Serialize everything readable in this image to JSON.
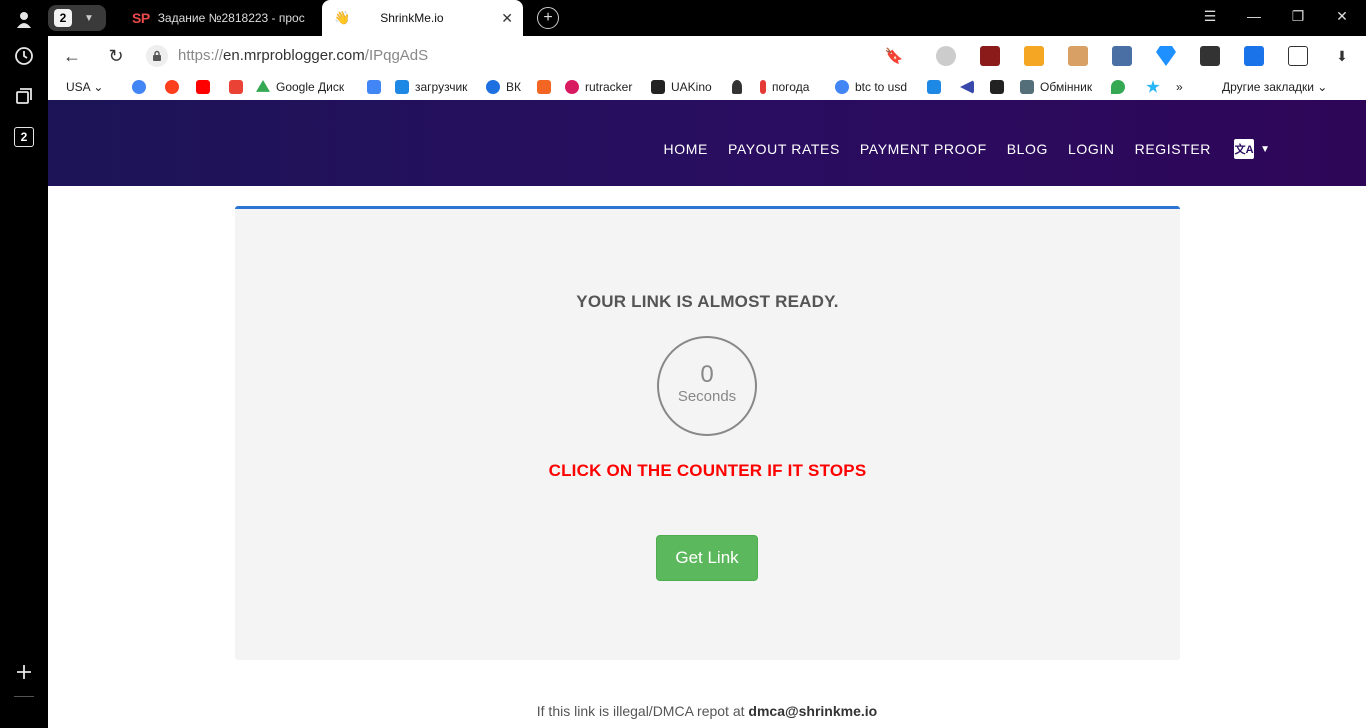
{
  "tabstrip": {
    "tab_count": "2",
    "tabs": [
      {
        "favicon": "SP",
        "title": "Задание №2818223 - прос"
      },
      {
        "favicon": "👋",
        "title": "ShrinkMe.io"
      }
    ],
    "new_tab": "+",
    "close": "✕"
  },
  "sidepanel": {
    "badge": "2"
  },
  "addressbar": {
    "protocol": "https://",
    "host": "en.mrproblogger.com",
    "path": "/IPqgAdS"
  },
  "bookmarks": {
    "items": [
      {
        "label": "USA ⌄",
        "icon": "none"
      },
      {
        "label": "",
        "icon": "google-icon",
        "color": "#4285f4"
      },
      {
        "label": "",
        "icon": "yandex-icon",
        "color": "#fc3f1d"
      },
      {
        "label": "",
        "icon": "youtube-icon",
        "color": "#ff0000"
      },
      {
        "label": "",
        "icon": "gmail-icon",
        "color": "#ea4335"
      },
      {
        "label": "Google Диск",
        "icon": "google-drive-icon",
        "color": "#34a853"
      },
      {
        "label": "",
        "icon": "translate-icon",
        "color": "#4285f4"
      },
      {
        "label": "загрузчик",
        "icon": "loader-icon",
        "color": "#1e88e5"
      },
      {
        "label": "ВК",
        "icon": "video-icon",
        "color": "#1e6fe0"
      },
      {
        "label": "",
        "icon": "f-icon",
        "color": "#f26522"
      },
      {
        "label": "rutracker",
        "icon": "rutracker-icon",
        "color": "#d81b60"
      },
      {
        "label": "UAKino",
        "icon": "uakino-icon",
        "color": "#222222"
      },
      {
        "label": "",
        "icon": "chess-icon",
        "color": "#333333"
      },
      {
        "label": "погода",
        "icon": "thermometer-icon",
        "color": "#e53935"
      },
      {
        "label": "btc to usd",
        "icon": "google-icon",
        "color": "#4285f4"
      },
      {
        "label": "",
        "icon": "p-icon",
        "color": "#1e88e5"
      },
      {
        "label": "",
        "icon": "arrow-icon",
        "color": "#3949ab"
      },
      {
        "label": "",
        "icon": "bc-icon",
        "color": "#222222"
      },
      {
        "label": "Обмінник",
        "icon": "exchange-icon",
        "color": "#546e7a"
      },
      {
        "label": "",
        "icon": "maps-icon",
        "color": "#34a853"
      },
      {
        "label": "",
        "icon": "star-icon",
        "color": "#29b6f6"
      },
      {
        "label": "»",
        "icon": "none"
      },
      {
        "label": "Другие закладки ⌄",
        "icon": "none"
      }
    ]
  },
  "site": {
    "menu": [
      "HOME",
      "PAYOUT RATES",
      "PAYMENT PROOF",
      "BLOG",
      "LOGIN",
      "REGISTER"
    ],
    "lang_flag": "文A"
  },
  "card": {
    "heading": "YOUR LINK IS ALMOST READY.",
    "counter_value": "0",
    "counter_unit": "Seconds",
    "warning": "CLICK ON THE COUNTER IF IT STOPS",
    "button": "Get Link"
  },
  "footer": {
    "text": "If this link is illegal/DMCA repot at ",
    "email": "dmca@shrinkme.io"
  },
  "colors": {
    "nav_gradient_start": "#1c1457",
    "nav_gradient_end": "#2e0658",
    "card_accent": "#2b74d2",
    "warning": "#ff0000",
    "button": "#5cb85c"
  }
}
